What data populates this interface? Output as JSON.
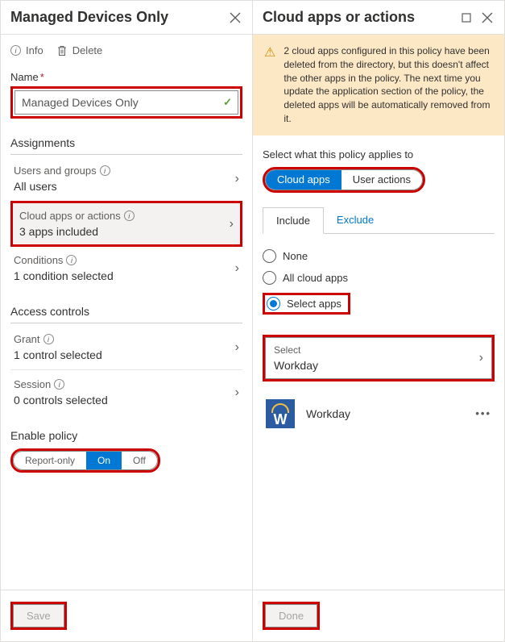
{
  "left": {
    "title": "Managed Devices Only",
    "info": "Info",
    "delete": "Delete",
    "nameLabel": "Name",
    "nameValue": "Managed Devices Only",
    "assignmentsHeading": "Assignments",
    "usersGroups": {
      "title": "Users and groups",
      "value": "All users"
    },
    "cloudApps": {
      "title": "Cloud apps or actions",
      "value": "3 apps included"
    },
    "conditions": {
      "title": "Conditions",
      "value": "1 condition selected"
    },
    "accessControlsHeading": "Access controls",
    "grant": {
      "title": "Grant",
      "value": "1 control selected"
    },
    "session": {
      "title": "Session",
      "value": "0 controls selected"
    },
    "enablePolicyHeading": "Enable policy",
    "toggle": {
      "reportOnly": "Report-only",
      "on": "On",
      "off": "Off"
    },
    "save": "Save"
  },
  "right": {
    "title": "Cloud apps or actions",
    "warning": "2 cloud apps configured in this policy have been deleted from the directory, but this doesn't affect the other apps in the policy. The next time you update the application section of the policy, the deleted apps will be automatically removed from it.",
    "selectLabel": "Select what this policy applies to",
    "pills": {
      "cloudApps": "Cloud apps",
      "userActions": "User actions"
    },
    "tabs": {
      "include": "Include",
      "exclude": "Exclude"
    },
    "radios": {
      "none": "None",
      "all": "All cloud apps",
      "select": "Select apps"
    },
    "selectBox": {
      "label": "Select",
      "value": "Workday"
    },
    "app": {
      "name": "Workday",
      "initial": "W"
    },
    "done": "Done"
  }
}
